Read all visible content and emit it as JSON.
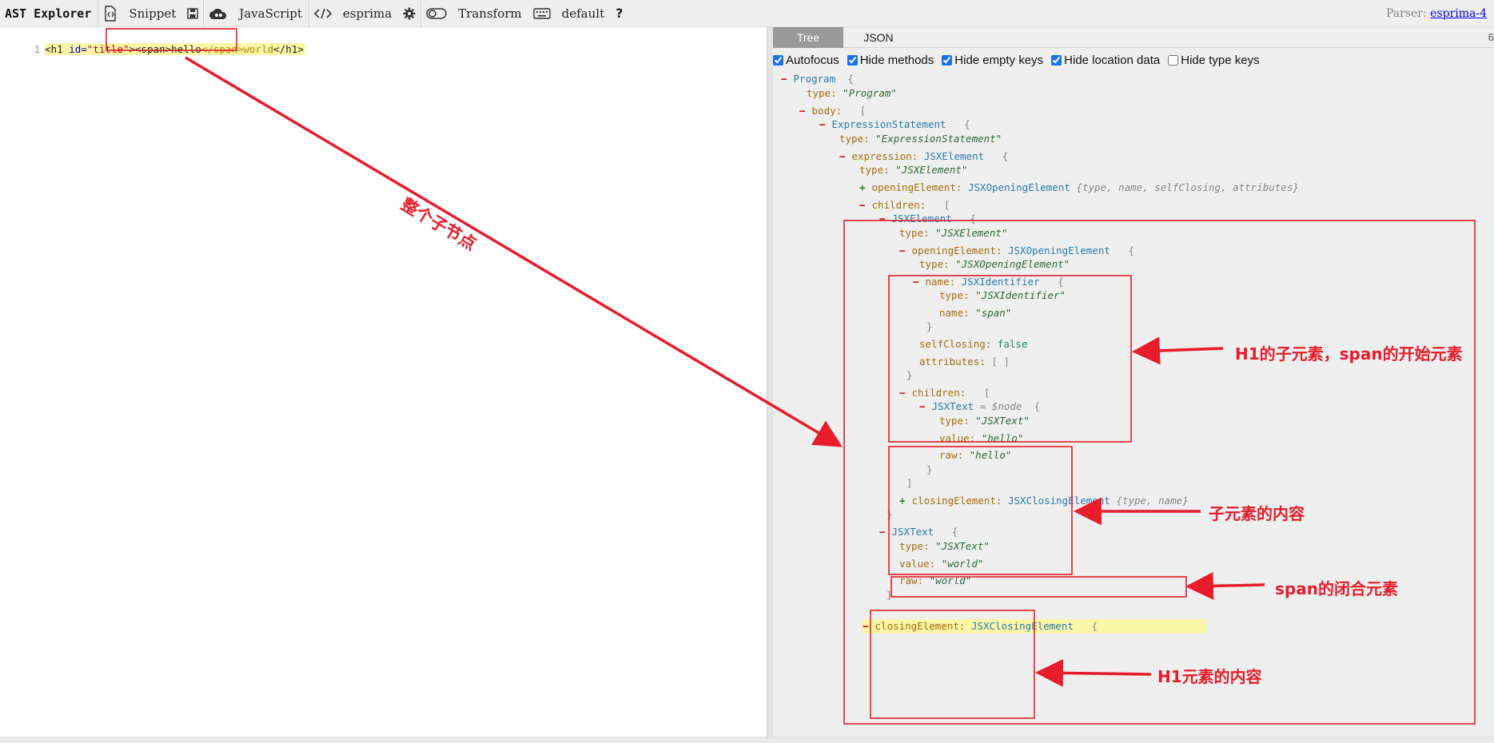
{
  "app": {
    "title": "AST Explorer",
    "snippet_label": "Snippet",
    "language_label": "JavaScript",
    "parser_name": "esprima",
    "transform_label": "Transform",
    "keymap_label": "default",
    "help_label": "?",
    "parser_info_label": "Parser:",
    "parser_link": "esprima-4"
  },
  "editor": {
    "line_number": "1",
    "code_tokens": [
      "<h1",
      " id=",
      "\"title\"",
      "><span>hello</span>world</h1>"
    ],
    "code_parts": {
      "open_h1": "<h1",
      "attr_id": " id=",
      "attr_val": "\"title\"",
      "gt": ">",
      "span_open": "<span>",
      "hello": "hello",
      "span_close": "</span>",
      "world": "world",
      "h1_close": "</h1>"
    }
  },
  "panel": {
    "tabs": [
      "Tree",
      "JSON"
    ],
    "active_tab": "Tree",
    "edge_text": "6",
    "options": [
      {
        "label": "Autofocus",
        "checked": true
      },
      {
        "label": "Hide methods",
        "checked": true
      },
      {
        "label": "Hide empty keys",
        "checked": true
      },
      {
        "label": "Hide location data",
        "checked": true
      },
      {
        "label": "Hide type keys",
        "checked": false
      }
    ]
  },
  "tree": {
    "program": "Program",
    "program_type_key": "type:",
    "program_type_val": "\"Program\"",
    "body_key": "body:",
    "expr_stmt": "ExpressionStatement",
    "expr_stmt_type_val": "\"ExpressionStatement\"",
    "expression_key": "expression:",
    "jsx_element": "JSXElement",
    "jsx_element_type_val": "\"JSXElement\"",
    "opening_element_key": "openingElement:",
    "jsx_opening_element": "JSXOpeningElement",
    "opening_summary": "{type, name, selfClosing, attributes}",
    "children_key": "children:",
    "inner_jsx_element": "JSXElement",
    "inner_type_val": "\"JSXElement\"",
    "inner_opening_key": "openingElement:",
    "inner_opening_type": "JSXOpeningElement",
    "inner_opening_type_val": "\"JSXOpeningElement\"",
    "name_key": "name:",
    "jsx_identifier": "JSXIdentifier",
    "jsx_identifier_type_val": "\"JSXIdentifier\"",
    "name_val": "\"span\"",
    "self_closing_key": "selfClosing:",
    "self_closing_val": "false",
    "attributes_key": "attributes:",
    "attributes_val": "[ ]",
    "inner_children_key": "children:",
    "jsx_text": "JSXText",
    "node_hint": "= $node",
    "jsx_text_type_val": "\"JSXText\"",
    "value_key": "value:",
    "hello_val": "\"hello\"",
    "raw_key": "raw:",
    "closing_key": "closingElement:",
    "jsx_closing_element": "JSXClosingElement",
    "closing_summary": "{type, name}",
    "jsx_text2": "JSXText",
    "world_val": "\"world\"",
    "bottom_closing_key": "closingElement:",
    "bottom_closing_type": "JSXClosingElement"
  },
  "annotations": {
    "whole_child_node": "整个子节点",
    "opening_note": "H1的子元素，span的开始元素",
    "content_note": "子元素的内容",
    "closing_note": "span的闭合元素",
    "h1_content_note": "H1元素的内容",
    "accent_color": "#e81c2a"
  }
}
